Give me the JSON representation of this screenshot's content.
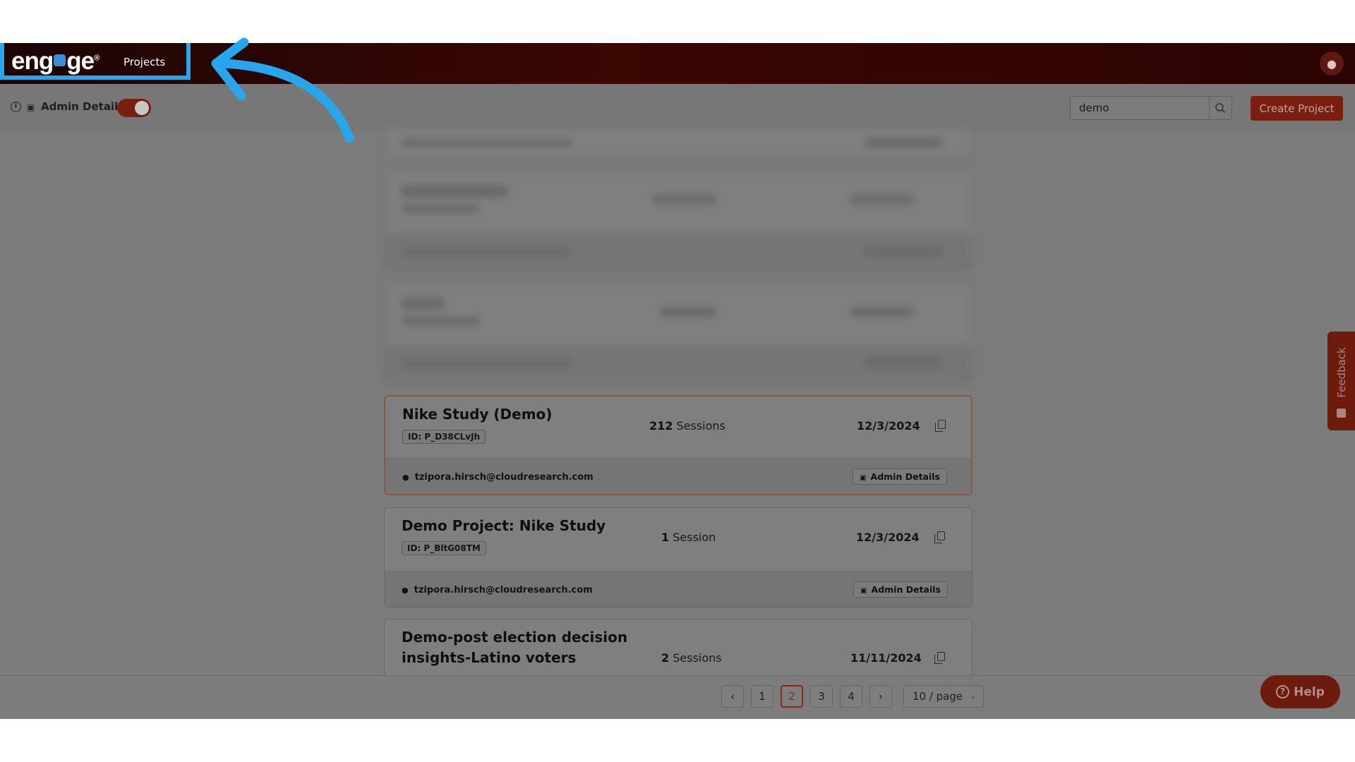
{
  "header": {
    "logo_text": "eng",
    "logo_text_end": "ge",
    "nav_projects": "Projects",
    "avatar_icon": "user-icon"
  },
  "toolbar": {
    "admin_label": "Admin Details",
    "admin_toggle_on": true,
    "search_value": "demo",
    "create_label": "Create Project"
  },
  "projects": [
    {
      "title": "Nike Study (Demo)",
      "id": "ID: P_D38CLvJh",
      "sessions_count": "212",
      "sessions_label": "Sessions",
      "date": "12/3/2024",
      "owner": "tzipora.hirsch@cloudresearch.com",
      "admin_label": "Admin Details"
    },
    {
      "title": "Demo Project: Nike Study",
      "id": "ID: P_BltG08TM",
      "sessions_count": "1",
      "sessions_label": "Session",
      "date": "12/3/2024",
      "owner": "tzipora.hirsch@cloudresearch.com",
      "admin_label": "Admin Details"
    },
    {
      "title_line1": "Demo-post election decision",
      "title_line2": "insights-Latino voters",
      "sessions_count": "2",
      "sessions_label": "Sessions",
      "date": "11/11/2024"
    }
  ],
  "pagination": {
    "pages": [
      "1",
      "2",
      "3",
      "4"
    ],
    "active": "2",
    "page_size": "10 / page"
  },
  "help_label": "Help",
  "feedback_label": "Feedback",
  "colors": {
    "brand_accent": "#b5321a",
    "highlight_box": "#27a6ee",
    "annotation_arrow": "#27a6ee"
  }
}
